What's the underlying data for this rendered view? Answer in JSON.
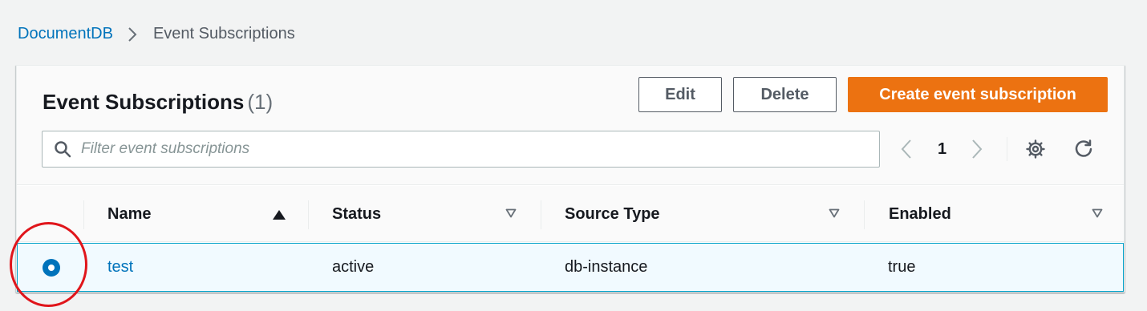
{
  "breadcrumb": {
    "root": "DocumentDB",
    "current": "Event Subscriptions"
  },
  "panel": {
    "title": "Event Subscriptions",
    "count": "(1)"
  },
  "actions": {
    "edit_label": "Edit",
    "delete_label": "Delete",
    "create_label": "Create event subscription"
  },
  "filter": {
    "placeholder": "Filter event subscriptions",
    "value": ""
  },
  "pagination": {
    "current_page": "1"
  },
  "table": {
    "columns": [
      {
        "label": "Name",
        "sort": "ascending"
      },
      {
        "label": "Status",
        "sort": "none"
      },
      {
        "label": "Source Type",
        "sort": "none"
      },
      {
        "label": "Enabled",
        "sort": "none"
      }
    ],
    "rows": [
      {
        "name": "test",
        "status": "active",
        "source_type": "db-instance",
        "enabled": "true",
        "selected": true
      }
    ]
  },
  "colors": {
    "accent": "#0073bb",
    "primary_button": "#ec7211",
    "selected_row_bg": "#f1faff",
    "selected_row_border": "#00a1c9",
    "annotation": "#e0151b"
  },
  "icons": [
    "chevron-right-icon",
    "search-icon",
    "chevron-left-icon",
    "settings-icon",
    "refresh-icon",
    "sort-ascending-icon",
    "sort-icon"
  ]
}
